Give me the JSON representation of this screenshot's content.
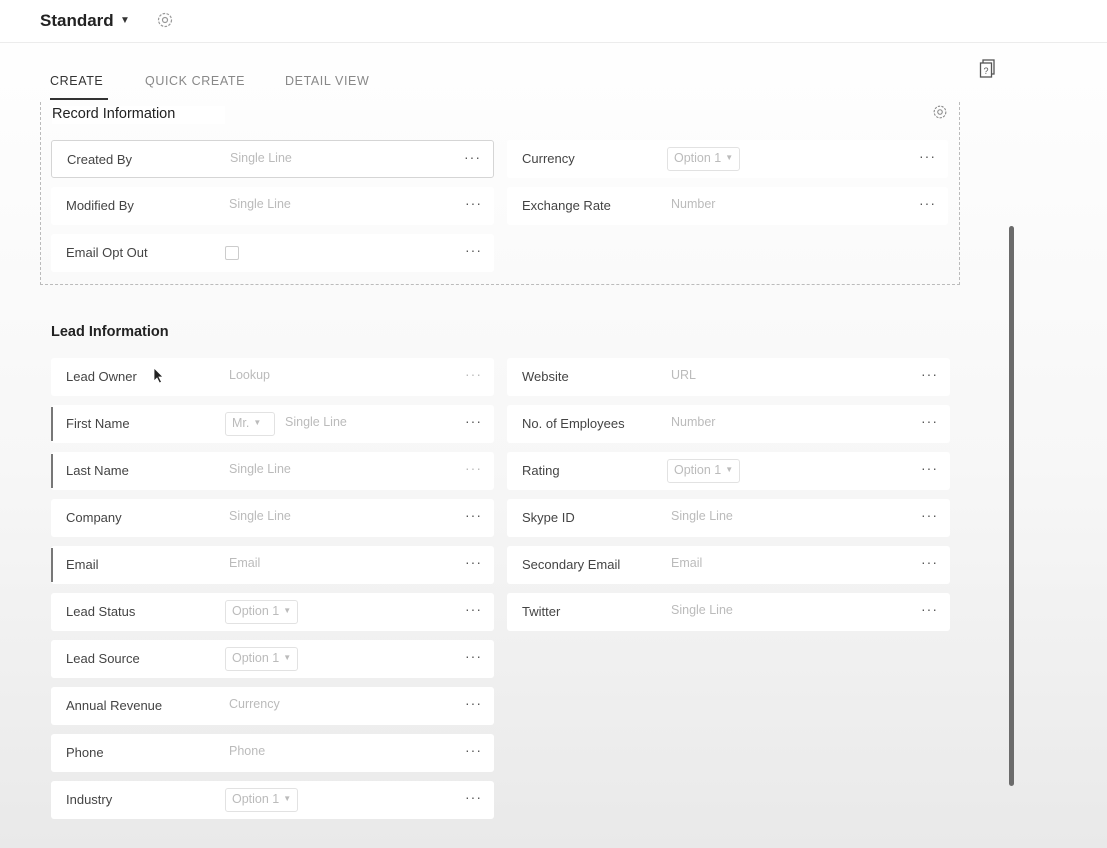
{
  "header": {
    "layout_name": "Standard"
  },
  "tabs": [
    {
      "label": "CREATE"
    },
    {
      "label": "QUICK CREATE"
    },
    {
      "label": "DETAIL VIEW"
    }
  ],
  "record_section": {
    "title": "Record Information",
    "left": [
      {
        "label": "Created By",
        "placeholder": "Single Line"
      },
      {
        "label": "Modified By",
        "placeholder": "Single Line"
      },
      {
        "label": "Email Opt Out",
        "placeholder": ""
      }
    ],
    "right": [
      {
        "label": "Currency",
        "placeholder": "Option 1"
      },
      {
        "label": "Exchange Rate",
        "placeholder": "Number"
      }
    ]
  },
  "lead_section": {
    "title": "Lead Information",
    "left": [
      {
        "label": "Lead Owner",
        "placeholder": "Lookup"
      },
      {
        "label": "First Name",
        "salutation": "Mr.",
        "placeholder": "Single Line"
      },
      {
        "label": "Last Name",
        "placeholder": "Single Line"
      },
      {
        "label": "Company",
        "placeholder": "Single Line"
      },
      {
        "label": "Email",
        "placeholder": "Email"
      },
      {
        "label": "Lead Status",
        "placeholder": "Option 1"
      },
      {
        "label": "Lead Source",
        "placeholder": "Option 1"
      },
      {
        "label": "Annual Revenue",
        "placeholder": "Currency"
      },
      {
        "label": "Phone",
        "placeholder": "Phone"
      },
      {
        "label": "Industry",
        "placeholder": "Option 1"
      }
    ],
    "right": [
      {
        "label": "Website",
        "placeholder": "URL"
      },
      {
        "label": "No. of Employees",
        "placeholder": "Number"
      },
      {
        "label": "Rating",
        "placeholder": "Option 1"
      },
      {
        "label": "Skype ID",
        "placeholder": "Single Line"
      },
      {
        "label": "Secondary Email",
        "placeholder": "Email"
      },
      {
        "label": "Twitter",
        "placeholder": "Single Line"
      }
    ]
  },
  "icons": {
    "field_menu": "more-dots-icon",
    "settings": "gear-icon",
    "help": "help-icon",
    "dropdown": "caret-down-icon"
  },
  "colors": {
    "text": "#333333",
    "placeholder": "#bbbbbb",
    "background": "#ffffff"
  }
}
